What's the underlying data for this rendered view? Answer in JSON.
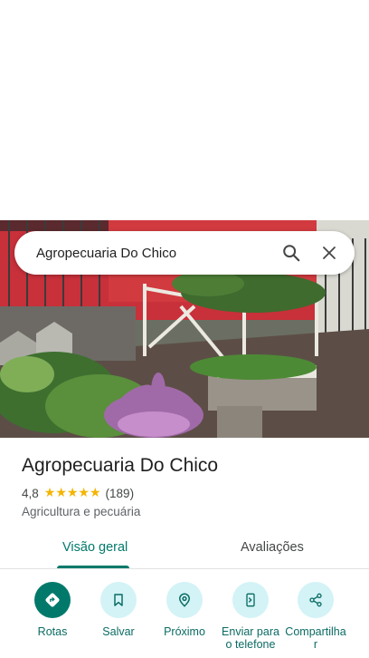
{
  "search": {
    "query": "Agropecuaria Do Chico",
    "search_icon": "search-icon",
    "close_icon": "close-icon"
  },
  "place": {
    "name": "Agropecuaria Do Chico",
    "rating": "4,8",
    "rating_value": 4.8,
    "stars": "★★★★★",
    "review_count": "(189)",
    "category": "Agricultura e pecuária"
  },
  "tabs": [
    {
      "label": "Visão geral",
      "selected": true
    },
    {
      "label": "Avaliações",
      "selected": false
    }
  ],
  "actions": [
    {
      "label": "Rotas",
      "icon": "directions-icon"
    },
    {
      "label": "Salvar",
      "icon": "bookmark-icon"
    },
    {
      "label": "Próximo",
      "icon": "nearby-icon"
    },
    {
      "label": "Enviar para o telefone",
      "icon": "send-to-phone-icon"
    },
    {
      "label": "Compartilhar",
      "icon": "share-icon"
    }
  ],
  "colors": {
    "accent": "#00796b",
    "action_bg": "#d3f3f6",
    "star": "#f4b400"
  }
}
